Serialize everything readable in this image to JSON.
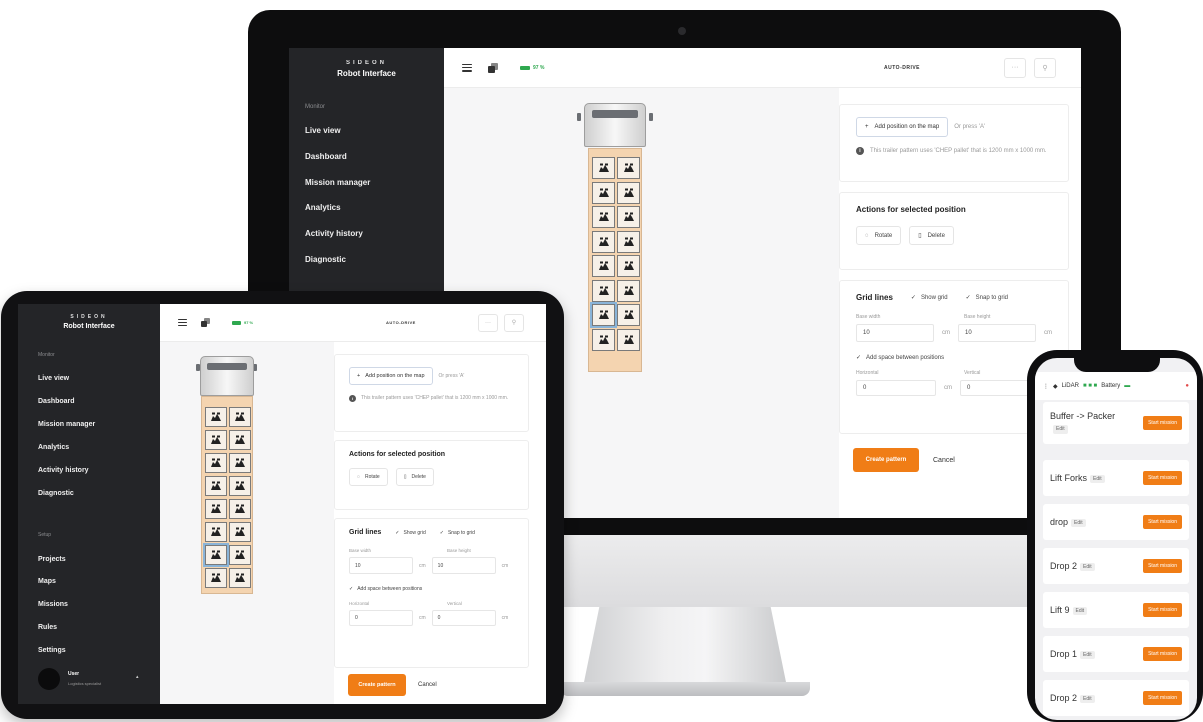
{
  "app": {
    "logo": "SIDEON",
    "subtitle": "Robot Interface",
    "section_monitor": "Monitor",
    "section_setup": "Setup",
    "monitor_items": [
      "Live view",
      "Dashboard",
      "Mission manager",
      "Analytics",
      "Activity history",
      "Diagnostic"
    ],
    "setup_items": [
      "Projects",
      "Maps",
      "Missions",
      "Rules",
      "Settings"
    ],
    "user_name": "User",
    "user_role": "Logistics specialist",
    "battery": "97 %",
    "mode": "AUTO-DRIVE",
    "more_label": "···"
  },
  "editor": {
    "add_position": "Add position on the map",
    "or_press": "Or press 'A'",
    "info_text": "This trailer pattern uses 'CHEP pallet' that is 1200 mm x 1000 mm.",
    "actions_title": "Actions for selected position",
    "rotate": "Rotate",
    "delete": "Delete",
    "grid_title": "Grid lines",
    "show_grid": "Show grid",
    "snap_grid": "Snap to grid",
    "base_width_label": "Base width",
    "base_height_label": "Base height",
    "base_width": "10",
    "base_height": "10",
    "unit": "cm",
    "space_between": "Add space between positions",
    "horizontal_label": "Horizontal",
    "vertical_label": "Vertical",
    "horizontal": "0",
    "vertical": "0",
    "create": "Create pattern",
    "cancel": "Cancel"
  },
  "phone": {
    "status_lidar": "LiDAR",
    "status_battery": "Battery",
    "missions": [
      {
        "name": "Buffer -> Packer",
        "tag": "Edit",
        "action": "Start mission"
      },
      {
        "name": "Lift Forks",
        "tag": "Edit",
        "action": "Start mission"
      },
      {
        "name": "drop",
        "tag": "Edit",
        "action": "Start mission"
      },
      {
        "name": "Drop 2",
        "tag": "Edit",
        "action": "Start mission"
      },
      {
        "name": "Lift 9",
        "tag": "Edit",
        "action": "Start mission"
      },
      {
        "name": "Drop 1",
        "tag": "Edit",
        "action": "Start mission"
      },
      {
        "name": "Drop 2",
        "tag": "Edit",
        "action": "Start mission"
      }
    ]
  },
  "colors": {
    "accent": "#f07d16",
    "sidebar": "#242528",
    "battery": "#2fa84f"
  }
}
